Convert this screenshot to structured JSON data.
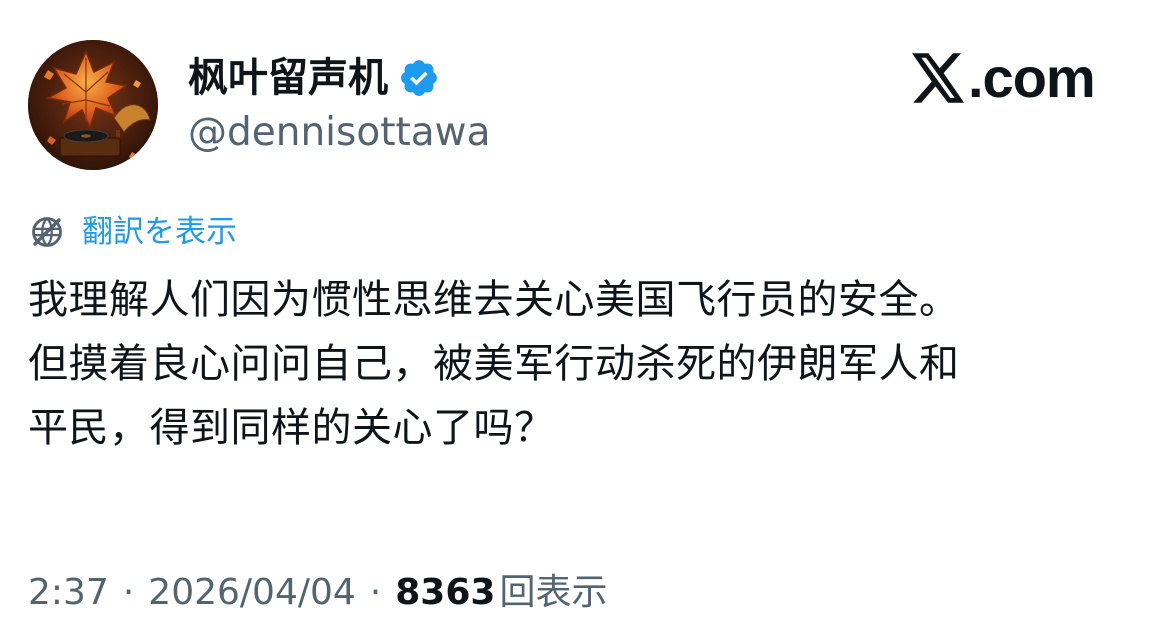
{
  "author": {
    "display_name": "枫叶留声机",
    "handle": "@dennisottawa",
    "verified": true,
    "verified_color": "#1d9bf0",
    "avatar_icon": "autumn-leaf-gramophone-avatar"
  },
  "brand": {
    "text": ".com",
    "logo_icon": "x-logo-icon"
  },
  "translate": {
    "label": "翻訳を表示",
    "icon": "globe-icon",
    "color": "#1d9bf0"
  },
  "tweet": {
    "lines": [
      "我理解人们因为惯性思维去关心美国飞行员的安全。",
      "但摸着良心问问自己，被美军行动杀死的伊朗军人和",
      "平民，得到同样的关心了吗？"
    ]
  },
  "meta": {
    "time": "2:37",
    "separator": "·",
    "date": "2026/04/04",
    "views_count": "8363",
    "views_label": "回表示"
  },
  "colors": {
    "text_primary": "#0f1419",
    "text_secondary": "#536471",
    "accent": "#1d9bf0"
  }
}
